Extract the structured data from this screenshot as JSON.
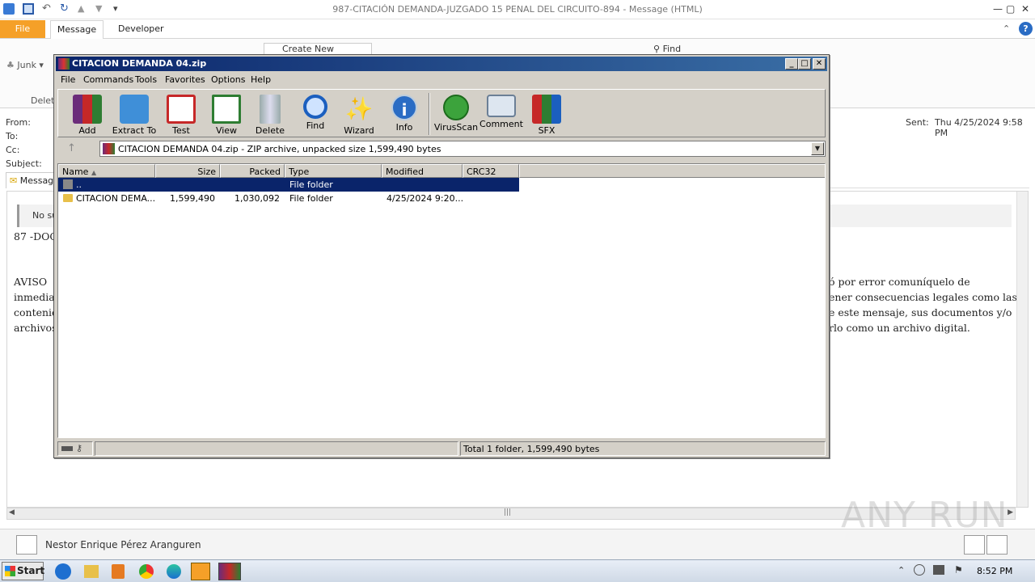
{
  "outlook": {
    "title": "987-CITACIÓN  DEMANDA-JUZGADO 15 PENAL DEL CIRCUITO-894  -  Message (HTML)",
    "tabs": {
      "file": "File",
      "message": "Message",
      "developer": "Developer"
    },
    "ribbon": {
      "junk": "Junk",
      "delete_group": "Delet",
      "create_new": "Create New",
      "find": "Find"
    },
    "header": {
      "from": "From:",
      "to": "To:",
      "cc": "Cc:",
      "subject": "Subject:",
      "sent_label": "Sent:",
      "sent_value": "Thu 4/25/2024 9:58 PM",
      "message_tab": "Messag"
    },
    "body": {
      "infobar": "No su",
      "line1": "87 -DOC",
      "aviso_left": [
        "AVISO",
        "inmediat",
        "contenid",
        "archivos"
      ],
      "aviso_right": [
        "ó por error comuníquelo de",
        "ener consecuencias legales como las",
        "e este mensaje, sus documentos y/o",
        "rlo como un archivo digital."
      ]
    },
    "people": {
      "name": "Nestor Enrique Pérez Aranguren"
    }
  },
  "winrar": {
    "title": "CITACION DEMANDA 04.zip",
    "menu": [
      "File",
      "Commands",
      "Tools",
      "Favorites",
      "Options",
      "Help"
    ],
    "toolbar": [
      "Add",
      "Extract To",
      "Test",
      "View",
      "Delete",
      "Find",
      "Wizard",
      "Info",
      "VirusScan",
      "Comment",
      "SFX"
    ],
    "address": "CITACION DEMANDA 04.zip - ZIP archive, unpacked size 1,599,490 bytes",
    "columns": [
      "Name",
      "Size",
      "Packed",
      "Type",
      "Modified",
      "CRC32"
    ],
    "rows": [
      {
        "name": "..",
        "size": "",
        "packed": "",
        "type": "File folder",
        "modified": "",
        "crc": ""
      },
      {
        "name": "CITACION DEMA...",
        "size": "1,599,490",
        "packed": "1,030,092",
        "type": "File folder",
        "modified": "4/25/2024 9:20...",
        "crc": ""
      }
    ],
    "status": "Total 1 folder, 1,599,490 bytes"
  },
  "taskbar": {
    "start": "Start",
    "clock": "8:52 PM"
  },
  "watermark": "ANY RUN",
  "colors": {
    "file_tab": "#f5a028",
    "rar_title": "#0a246a",
    "selection": "#0a246a"
  }
}
